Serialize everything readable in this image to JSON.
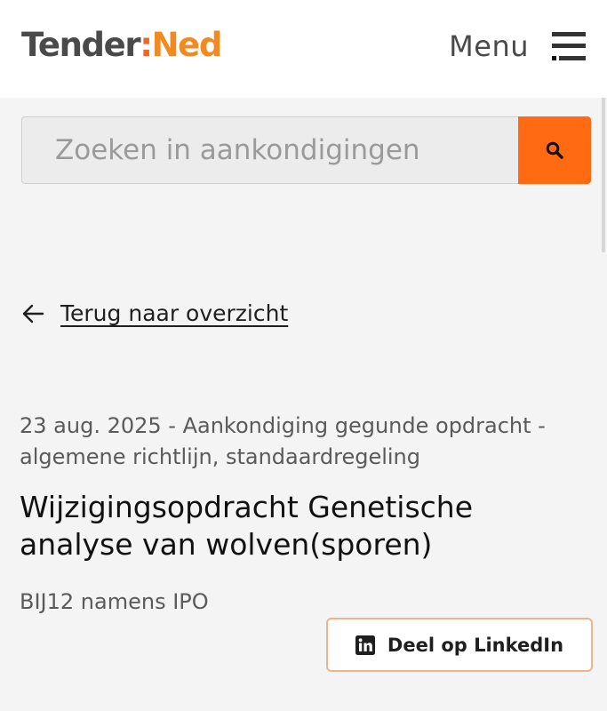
{
  "header": {
    "logo_part1": "Tender",
    "logo_colon": ":",
    "logo_part2": "Ned",
    "menu_label": "Menu"
  },
  "search": {
    "placeholder": "Zoeken in aankondigingen",
    "value": ""
  },
  "nav": {
    "back_label": "Terug naar overzicht"
  },
  "notice": {
    "meta": "23 aug. 2025 - Aankondiging gegunde opdracht - algemene richtlijn, standaardregeling",
    "title": "Wijzigingsopdracht Genetische analyse van wolven(sporen)",
    "organization": "BIJ12 namens IPO"
  },
  "share": {
    "linkedin_label": "Deel op LinkedIn"
  },
  "colors": {
    "brand_orange": "#ff6a13",
    "logo_ned": "#f28a22",
    "logo_tender": "#4a4a4a"
  },
  "icons": {
    "search": "search-icon",
    "menu": "hamburger-icon",
    "back": "arrow-left-icon",
    "linkedin": "linkedin-icon"
  }
}
